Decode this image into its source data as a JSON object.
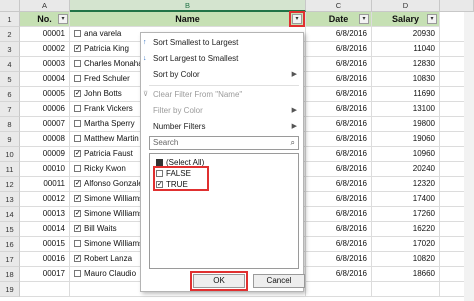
{
  "columns": [
    "A",
    "B",
    "C",
    "D"
  ],
  "rows": [
    "1",
    "2",
    "3",
    "4",
    "5",
    "6",
    "7",
    "8",
    "9",
    "10",
    "11",
    "12",
    "13",
    "14",
    "15",
    "16",
    "17",
    "18",
    "19"
  ],
  "headers": {
    "no": "No.",
    "name": "Name",
    "date": "Date",
    "salary": "Salary"
  },
  "filter_arrow": "▾",
  "data": [
    {
      "no": "00001",
      "checked": false,
      "name": "ana varela",
      "date": "6/8/2016",
      "salary": "20930"
    },
    {
      "no": "00002",
      "checked": true,
      "name": "Patricia King",
      "date": "6/8/2016",
      "salary": "11040"
    },
    {
      "no": "00003",
      "checked": false,
      "name": "Charles Monahan",
      "date": "6/8/2016",
      "salary": "12830"
    },
    {
      "no": "00004",
      "checked": false,
      "name": "Fred Schuler",
      "date": "6/8/2016",
      "salary": "10830"
    },
    {
      "no": "00005",
      "checked": true,
      "name": "John Botts",
      "date": "6/8/2016",
      "salary": "11690"
    },
    {
      "no": "00006",
      "checked": false,
      "name": "Frank Vickers",
      "date": "6/8/2016",
      "salary": "13100"
    },
    {
      "no": "00007",
      "checked": false,
      "name": "Martha Sperry",
      "date": "6/8/2016",
      "salary": "19800"
    },
    {
      "no": "00008",
      "checked": false,
      "name": "Matthew Martin",
      "date": "6/8/2016",
      "salary": "19060"
    },
    {
      "no": "00009",
      "checked": true,
      "name": "Patricia Faust",
      "date": "6/8/2016",
      "salary": "10960"
    },
    {
      "no": "00010",
      "checked": false,
      "name": "Ricky Kwon",
      "date": "6/8/2016",
      "salary": "20240"
    },
    {
      "no": "00011",
      "checked": true,
      "name": "Alfonso Gonzalez",
      "date": "6/8/2016",
      "salary": "12320"
    },
    {
      "no": "00012",
      "checked": true,
      "name": "Simone Williams",
      "date": "6/8/2016",
      "salary": "17400"
    },
    {
      "no": "00013",
      "checked": true,
      "name": "Simone Williams",
      "date": "6/8/2016",
      "salary": "17260"
    },
    {
      "no": "00014",
      "checked": true,
      "name": "Bill Waits",
      "date": "6/8/2016",
      "salary": "16220"
    },
    {
      "no": "00015",
      "checked": false,
      "name": "Simone Williams",
      "date": "6/8/2016",
      "salary": "17020"
    },
    {
      "no": "00016",
      "checked": true,
      "name": "Robert Lanza",
      "date": "6/8/2016",
      "salary": "10820"
    },
    {
      "no": "00017",
      "checked": false,
      "name": "Mauro Claudio",
      "date": "6/8/2016",
      "salary": "18660"
    }
  ],
  "menu": {
    "sort_asc": "Sort Smallest to Largest",
    "sort_desc": "Sort Largest to Smallest",
    "sort_color": "Sort by Color",
    "clear_filter": "Clear Filter From \"Name\"",
    "filter_color": "Filter by Color",
    "number_filters": "Number Filters",
    "search_placeholder": "Search",
    "list": {
      "select_all": "(Select All)",
      "false": "FALSE",
      "true": "TRUE"
    },
    "ok": "OK",
    "cancel": "Cancel"
  },
  "colors": {
    "header_fill": "#c6e0b4",
    "highlight": "#e03030",
    "selected_col": "#217346"
  }
}
